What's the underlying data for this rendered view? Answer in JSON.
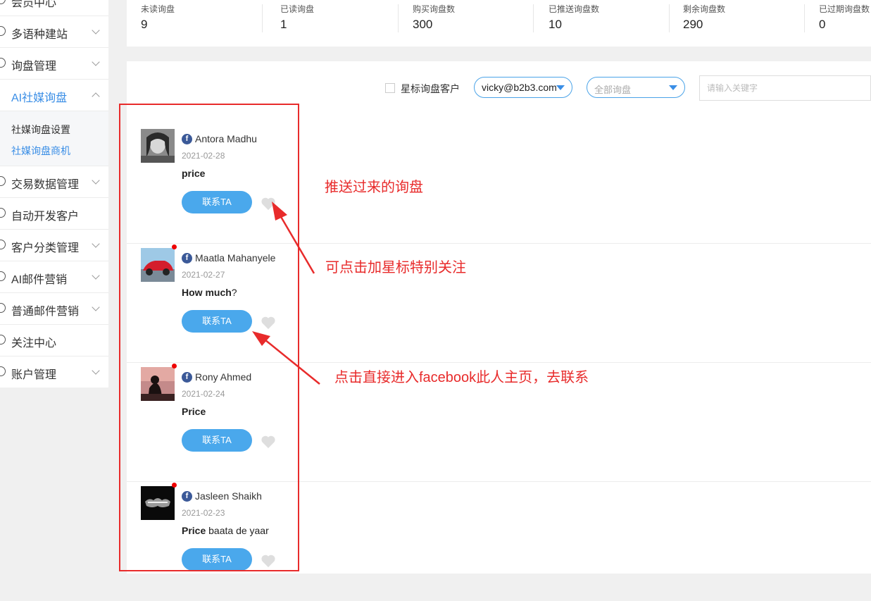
{
  "sidebar": {
    "partial_top": "会员中心",
    "items": [
      {
        "label": "多语种建站"
      },
      {
        "label": "询盘管理"
      },
      {
        "label": "AI社媒询盘"
      },
      {
        "label": "交易数据管理"
      },
      {
        "label": "自动开发客户"
      },
      {
        "label": "客户分类管理"
      },
      {
        "label": "AI邮件营销"
      },
      {
        "label": "普通邮件营销"
      },
      {
        "label": "关注中心"
      },
      {
        "label": "账户管理"
      }
    ],
    "subitems": [
      {
        "label": "社媒询盘设置"
      },
      {
        "label": "社媒询盘商机"
      }
    ]
  },
  "stats": [
    {
      "label": "未读询盘",
      "value": "9"
    },
    {
      "label": "已读询盘",
      "value": "1"
    },
    {
      "label": "购买询盘数",
      "value": "300"
    },
    {
      "label": "已推送询盘数",
      "value": "10"
    },
    {
      "label": "剩余询盘数",
      "value": "290"
    },
    {
      "label": "已过期询盘数",
      "value": "0"
    }
  ],
  "filters": {
    "star_label": "星标询盘客户",
    "account_value": "vicky@b2b3.com",
    "type_value": "全部询盘",
    "keyword_placeholder": "请输入关键字"
  },
  "cards": [
    {
      "name": "Antora Madhu",
      "date": "2021-02-28",
      "msg_bold": "price",
      "msg_rest": "",
      "unread": false,
      "btn": "联系TA"
    },
    {
      "name": "Maatla Mahanyele",
      "date": "2021-02-27",
      "msg_bold": "How much",
      "msg_rest": "?",
      "unread": true,
      "btn": "联系TA"
    },
    {
      "name": "Rony Ahmed",
      "date": "2021-02-24",
      "msg_bold": "Price",
      "msg_rest": "",
      "unread": true,
      "btn": "联系TA"
    },
    {
      "name": "Jasleen Shaikh",
      "date": "2021-02-23",
      "msg_bold": "Price",
      "msg_rest": " baata de yaar",
      "unread": true,
      "btn": "联系TA"
    }
  ],
  "fb_letter": "f",
  "annotations": {
    "note1": "推送过来的询盘",
    "note2": "可点击加星标特别关注",
    "note3": "点击直接进入facebook此人主页，去联系",
    "color": "#e82b2b"
  },
  "colors": {
    "accent": "#3a8ee6",
    "button": "#4aa8ec",
    "facebook": "#3b5998",
    "unread_dot": "#e00000"
  }
}
